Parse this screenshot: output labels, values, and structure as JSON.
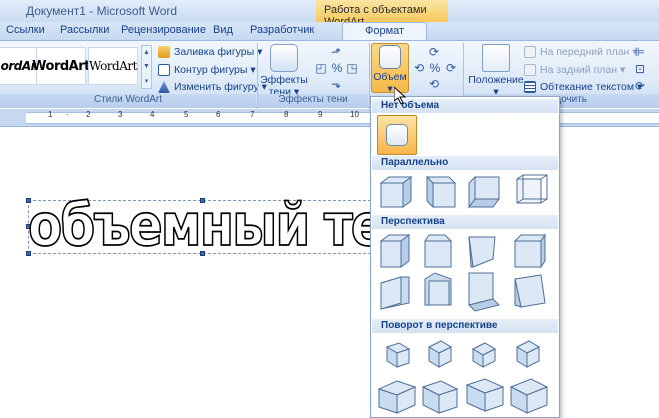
{
  "titlebar": {
    "title": "Документ1 - Microsoft Word",
    "contextual_title": "Работа с объектами WordArt"
  },
  "tabs": [
    {
      "label": "Ссылки"
    },
    {
      "label": "Рассылки"
    },
    {
      "label": "Рецензирование"
    },
    {
      "label": "Вид"
    },
    {
      "label": "Разработчик"
    },
    {
      "label": "Формат",
      "active": true
    }
  ],
  "wordart_styles": {
    "items": [
      {
        "label": "ordArt"
      },
      {
        "label": "WordArt"
      },
      {
        "label": "WordArt"
      }
    ],
    "commands": [
      "Заливка фигуры",
      "Контур фигуры",
      "Изменить фигуру"
    ],
    "group_label": "Стили WordArt"
  },
  "shadow_effects": {
    "button_label": "Эффекты тени",
    "group_label": "Эффекты тени"
  },
  "volume": {
    "button_label": "Объем"
  },
  "arrange": {
    "position_label": "Положение",
    "commands": [
      "На передний план",
      "На задний план",
      "Обтекание текстом"
    ],
    "group_label_fragment": "дочить"
  },
  "document": {
    "wordart_text": "объемный текст"
  },
  "gallery": {
    "sections": [
      "Нет объема",
      "Параллельно",
      "Перспектива",
      "Поворот в перспективе"
    ]
  },
  "colors": {
    "accent": "#15428b",
    "selected": "#f7b54b"
  }
}
